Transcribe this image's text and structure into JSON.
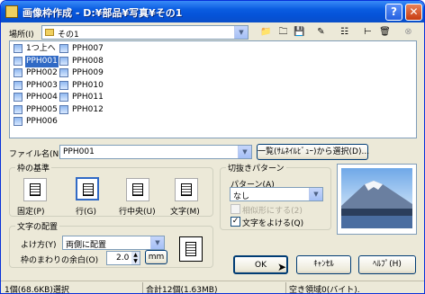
{
  "window": {
    "title": "画像枠作成 - D:¥部品¥写真¥その1"
  },
  "location": {
    "label": "場所(I)",
    "value": "その1"
  },
  "files": [
    {
      "name": "1つ上へ",
      "icon": "up-folder-icon"
    },
    {
      "name": "PPH001",
      "icon": "image-file-icon"
    },
    {
      "name": "PPH002",
      "icon": "image-file-icon"
    },
    {
      "name": "PPH003",
      "icon": "image-file-icon"
    },
    {
      "name": "PPH004",
      "icon": "image-file-icon"
    },
    {
      "name": "PPH005",
      "icon": "image-file-icon"
    },
    {
      "name": "PPH006",
      "icon": "image-file-icon"
    },
    {
      "name": "PPH007",
      "icon": "image-file-icon"
    },
    {
      "name": "PPH008",
      "icon": "image-file-icon"
    },
    {
      "name": "PPH009",
      "icon": "image-file-icon"
    },
    {
      "name": "PPH010",
      "icon": "image-file-icon"
    },
    {
      "name": "PPH011",
      "icon": "image-file-icon"
    },
    {
      "name": "PPH012",
      "icon": "image-file-icon"
    }
  ],
  "selected_file": "PPH001",
  "filename": {
    "label": "ファイル名(N)",
    "value": "PPH001"
  },
  "thumbnail_button": "一覧(ｻﾑﾈｲﾙﾋﾞｭｰ)から選択(D)...",
  "frame_basis": {
    "title": "枠の基準",
    "options": [
      "固定(P)",
      "行(G)",
      "行中央(U)",
      "文字(M)"
    ],
    "selected": "行(G)"
  },
  "text_layout": {
    "title": "文字の配置",
    "avoid_label": "よけ方(Y)",
    "avoid_value": "両側に配置",
    "margin_label": "枠のまわりの余白(O)",
    "margin_value": "2.0",
    "unit": "mm"
  },
  "cutout": {
    "title": "切抜きパターン",
    "pattern_label": "パターン(A)",
    "pattern_value": "なし",
    "similar_label": "相似形にする(2)",
    "avoid_text_label": "文字をよける(Q)",
    "avoid_text_checked": true
  },
  "buttons": {
    "ok": "OK",
    "cancel": "ｷｬﾝｾﾙ",
    "help": "ﾍﾙﾌﾟ(H)"
  },
  "status": {
    "selection": "1個(68.6KB)選択",
    "total": "合計12個(1.63MB)",
    "free": "空き領域0(バイト)."
  },
  "colors": {
    "title_bar": "#0a5ce0",
    "selection": "#316ac5",
    "dialog": "#ece9d8"
  }
}
